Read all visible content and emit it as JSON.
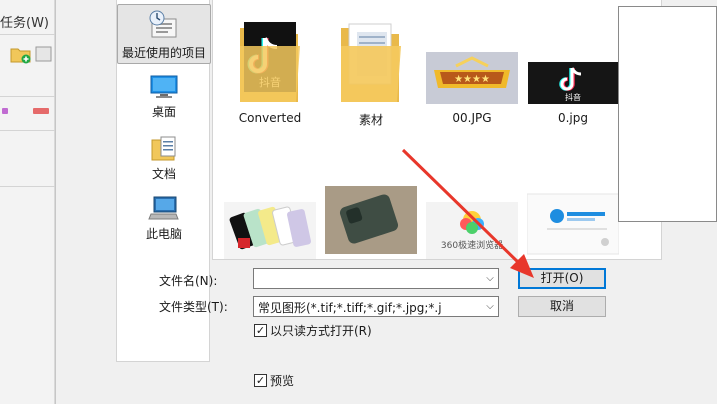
{
  "background_app": {
    "menu_fragment": "任务(W)"
  },
  "places": [
    {
      "label": "最近使用的项目",
      "icon": "recent-places-icon",
      "selected": true
    },
    {
      "label": "桌面",
      "icon": "desktop-icon",
      "selected": false
    },
    {
      "label": "文档",
      "icon": "documents-icon",
      "selected": false
    },
    {
      "label": "此电脑",
      "icon": "this-pc-icon",
      "selected": false
    }
  ],
  "files": [
    {
      "name": "Converted",
      "kind": "folder-douyin"
    },
    {
      "name": "素材",
      "kind": "folder"
    },
    {
      "name": "00.JPG",
      "kind": "image-game-banner"
    },
    {
      "name": "0.jpg",
      "kind": "image-douyin"
    },
    {
      "name": "",
      "kind": "image-phones"
    },
    {
      "name": "",
      "kind": "image-phone-dark"
    },
    {
      "name": "",
      "kind": "image-360-browser",
      "thumb_text": "360极速浏览器"
    },
    {
      "name": "",
      "kind": "image-ie-browser"
    }
  ],
  "form": {
    "filename_label": "文件名(N):",
    "filename_value": "",
    "filetype_label": "文件类型(T):",
    "filetype_value": "常见图形(*.tif;*.tiff;*.gif;*.jpg;*.j",
    "readonly_label": "以只读方式打开(R)",
    "readonly_checked": true,
    "preview_label": "预览",
    "preview_checked": true
  },
  "buttons": {
    "open": "打开(O)",
    "cancel": "取消"
  },
  "colors": {
    "accent": "#0078d7",
    "annotation_arrow": "#e8372b",
    "folder": "#f4c95d",
    "douyin_bg": "#111111"
  }
}
